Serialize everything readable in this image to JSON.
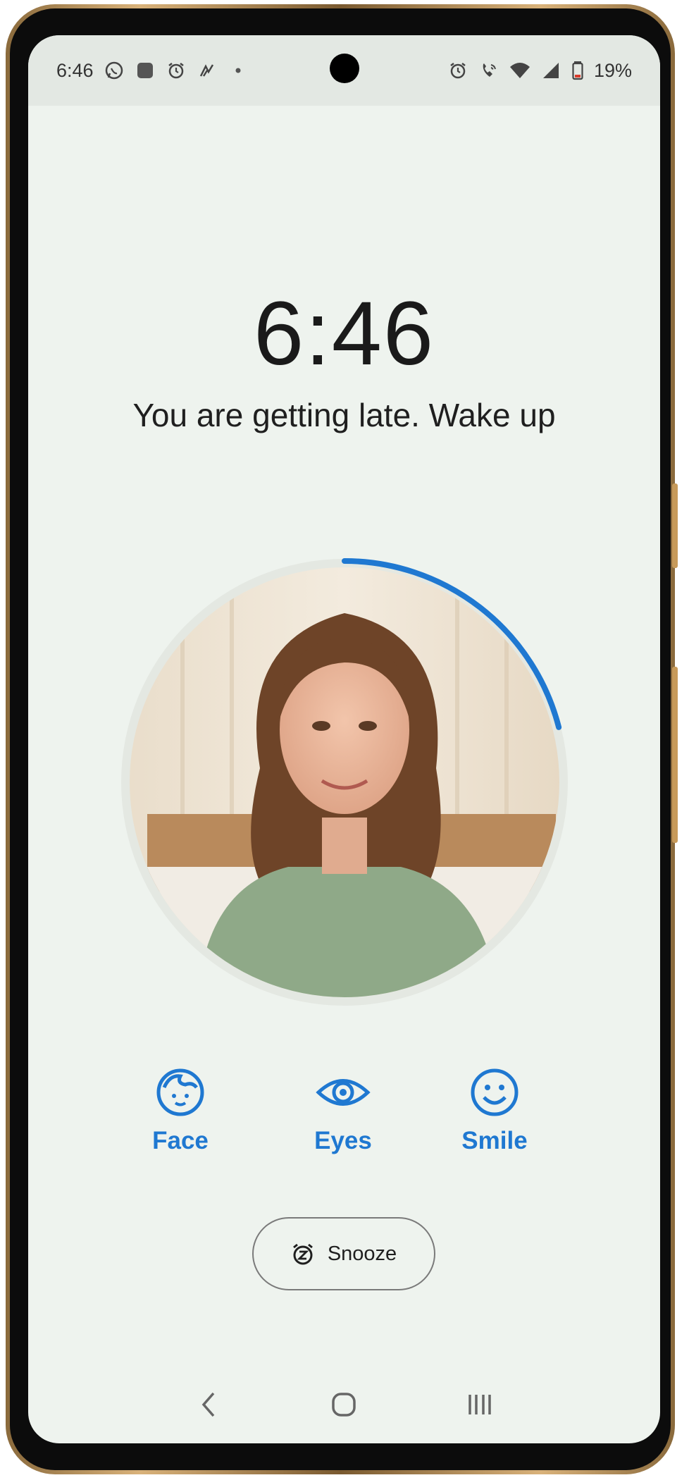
{
  "status_bar": {
    "time": "6:46",
    "battery": "19%"
  },
  "alarm": {
    "time": "6:46",
    "message": "You are getting late. Wake up",
    "progress_fraction": 0.21
  },
  "checks": [
    {
      "label": "Face",
      "icon": "face-icon"
    },
    {
      "label": "Eyes",
      "icon": "eye-icon"
    },
    {
      "label": "Smile",
      "icon": "smile-icon"
    }
  ],
  "snooze": {
    "label": "Snooze",
    "icon": "snooze-alarm-icon"
  },
  "colors": {
    "accent": "#1f78d1",
    "background": "#eef3ee"
  }
}
